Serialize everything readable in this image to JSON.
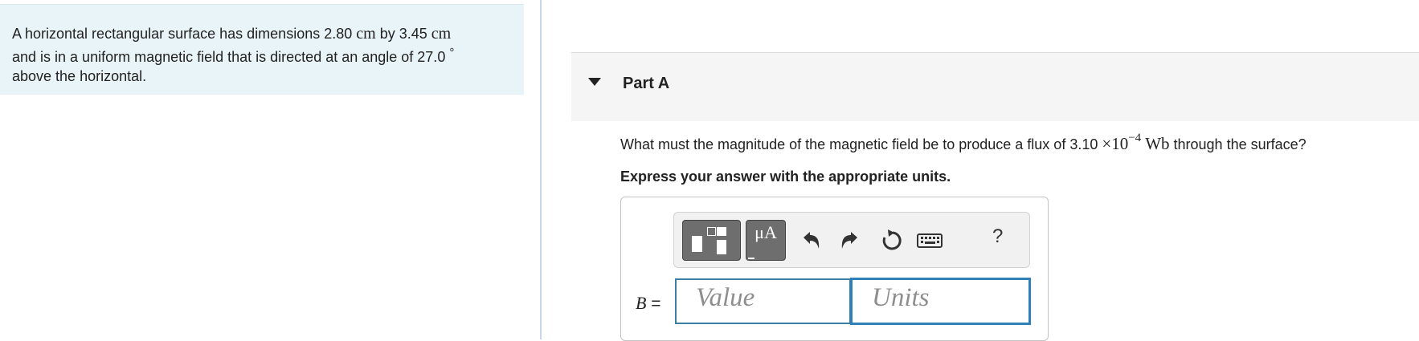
{
  "problem": {
    "pre1": "A horizontal rectangular surface has dimensions 2.80 ",
    "unit1": "cm",
    "mid1": " by 3.45 ",
    "unit2": "cm",
    "line2": "and is in a uniform magnetic field that is directed at an angle of 27.0 ",
    "degree": "°",
    "line3": "above the horizontal."
  },
  "part": {
    "title": "Part A"
  },
  "question": {
    "pre": "What must the magnitude of the magnetic field be to produce a flux of 3.10 ",
    "times": "×10",
    "exponent": "−4",
    "unit": "Wb",
    "post": " through the surface?"
  },
  "instruction": "Express your answer with the appropriate units.",
  "toolbar": {
    "units_label": "μA",
    "help_label": "?",
    "icons": [
      "templates-icon",
      "units-icon",
      "undo-icon",
      "redo-icon",
      "reset-icon",
      "keyboard-icon",
      "help-icon"
    ]
  },
  "answer": {
    "variable": "B",
    "equals": " =",
    "value_placeholder": "Value",
    "units_placeholder": "Units"
  }
}
